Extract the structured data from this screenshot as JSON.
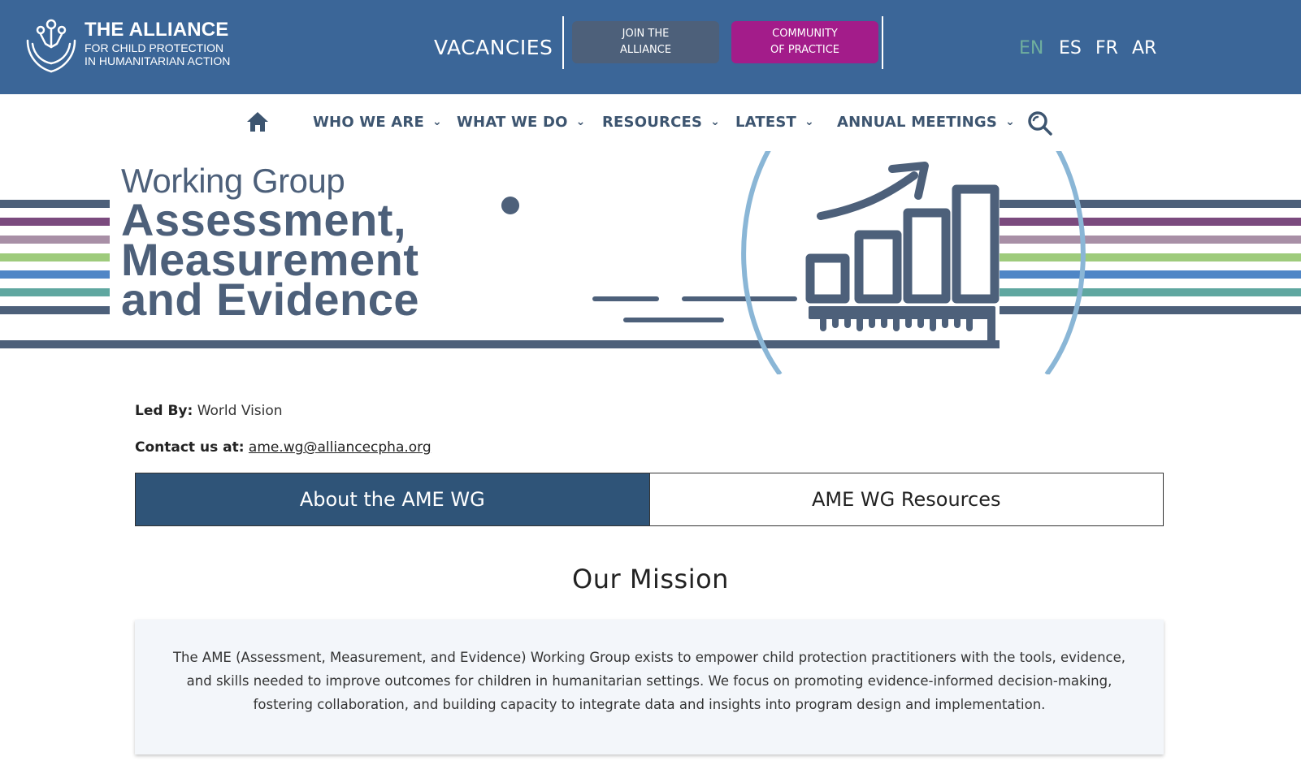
{
  "topbar": {
    "logo": {
      "title": "THE ALLIANCE",
      "subtitle_line1": "FOR CHILD PROTECTION",
      "subtitle_line2": "IN HUMANITARIAN ACTION"
    },
    "vacancies_label": "VACANCIES",
    "join_label_line1": "JOIN THE",
    "join_label_line2": "ALLIANCE",
    "cop_label_line1": "COMMUNITY",
    "cop_label_line2": "OF PRACTICE",
    "languages": [
      "EN",
      "ES",
      "FR",
      "AR"
    ],
    "active_language": "EN"
  },
  "nav": {
    "items": [
      {
        "label": "WHO WE ARE"
      },
      {
        "label": "WHAT WE DO"
      },
      {
        "label": "RESOURCES"
      },
      {
        "label": "LATEST"
      },
      {
        "label": "ANNUAL MEETINGS"
      }
    ],
    "chevron": "⌄",
    "icons": [
      "home-icon",
      "search-icon"
    ]
  },
  "banner": {
    "line1": "Working Group",
    "line2": "Assessment,",
    "line3": "Measurement",
    "line4": "and Evidence",
    "stripe_colors": [
      "#4d607a",
      "#7b4a7e",
      "#a88fa6",
      "#9ecb7c",
      "#4f86c6",
      "#5fa7a0",
      "#4d607a"
    ]
  },
  "info": {
    "led_by_label": "Led By:",
    "led_by_value": "World Vision",
    "contact_label": "Contact us at:",
    "contact_email": "ame.wg@alliancecpha.org"
  },
  "tabs": [
    {
      "label": "About the AME WG",
      "active": true
    },
    {
      "label": "AME WG Resources",
      "active": false
    }
  ],
  "mission": {
    "title": "Our Mission",
    "text": "The AME (Assessment, Measurement, and Evidence) Working Group exists to empower child protection practitioners with the tools, evidence, and skills needed to improve outcomes for children in humanitarian settings. We focus on promoting evidence-informed decision-making, fostering collaboration, and building capacity to integrate data and insights into program design and implementation."
  },
  "colors": {
    "topbar": "#3b6698",
    "join_button": "#4d607a",
    "cop_button": "#a31c8a",
    "active_language": "#6fae9e",
    "nav_text": "#3d5570",
    "active_tab": "#2f5478"
  }
}
